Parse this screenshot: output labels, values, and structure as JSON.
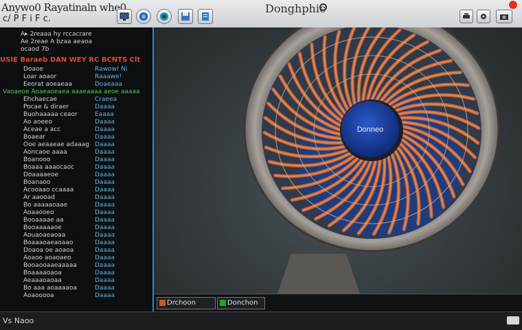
{
  "toolbar": {
    "title": "Anywo0 Rayatinaln whe0",
    "sub_left": "c/ P F i F c.",
    "window_title": "Donghphic"
  },
  "code_panel": {
    "header": "USIE Baraeb DAN WEY RC BCNTS Clt",
    "lines": [
      {
        "a": "A▸ 2reaaa  hy rccacrare",
        "b": ""
      },
      {
        "a": "Ae 2reae  A bzaa aeaoa",
        "b": ""
      },
      {
        "a": "  ocaod 7b",
        "b": ""
      },
      {
        "a": "Doaoe",
        "b": "Rawow! Ni"
      },
      {
        "a": "Loar aoaor",
        "b": "Raaawe!"
      },
      {
        "a": "Eeorat aoeaeaa",
        "b": "Doaeaaa"
      },
      {
        "a": "Ehchaecae",
        "b": "Craeea"
      },
      {
        "a": "Pocae  & diraer",
        "b": "Daaaa"
      },
      {
        "a": "Buohaaaaa ceaor",
        "b": "Eaaaa"
      },
      {
        "a": "Ao aoeeo",
        "b": "Daaaa"
      },
      {
        "a": "Aceae a acc",
        "b": "Daaaa"
      },
      {
        "a": "Boaear",
        "b": "Daaaa"
      },
      {
        "a": "Ooe aeaaeae adaaag",
        "b": "Daaaa"
      },
      {
        "a": "Aoncaoe aaaa",
        "b": "Daaaa"
      },
      {
        "a": "Boanooo",
        "b": "Daaaa"
      },
      {
        "a": "Boaaa aaaocaoc",
        "b": "Daaaa"
      },
      {
        "a": "Doaaaaeoe",
        "b": "Daaaa"
      },
      {
        "a": "Boanaoo",
        "b": "Daaaa"
      },
      {
        "a": "Acooaao ccaaaa",
        "b": "Daaaa"
      },
      {
        "a": "Ar aaooad",
        "b": "Daaaa"
      },
      {
        "a": "Bo aaaaaoaae",
        "b": "Daaaa"
      },
      {
        "a": "Aoaaooeo",
        "b": "Daaaa"
      },
      {
        "a": "Booaaaae aa",
        "b": "Daaaa"
      },
      {
        "a": "Booaaaaaoe",
        "b": "Daaaa"
      },
      {
        "a": "Aouaoaeaoaa",
        "b": "Daaaa"
      },
      {
        "a": "Boaaaoaeaoaao",
        "b": "Daaaa"
      },
      {
        "a": "Doaoa oe aoaoa",
        "b": "Daaaa"
      },
      {
        "a": "Aoaoo aoaoaeo",
        "b": "Daaaa"
      },
      {
        "a": "Booaooaaeaaaaa",
        "b": "Daaaa"
      },
      {
        "a": "Boaaaaoaoa",
        "b": "Daaaa"
      },
      {
        "a": "Aeaaaoaoaa",
        "b": "Daaaa"
      },
      {
        "a": "Bo aaa aoaaaaoa",
        "b": "Daaaa"
      },
      {
        "a": "Aoaooooa",
        "b": "Daaaa"
      }
    ],
    "green_line": "Vaoaeoe Aoaeaoeaea aaaeaaaa aeoe aaaaa",
    "status": "Vs Naoo"
  },
  "viewport": {
    "hub_label": "Donneo",
    "footer_left": "Drchoon",
    "footer_right": "Donchon"
  },
  "colors": {
    "blade": "#c8683a",
    "hub": "#1a3f9e",
    "frame": "#8e8a86",
    "accent": "#3b7fd0"
  }
}
